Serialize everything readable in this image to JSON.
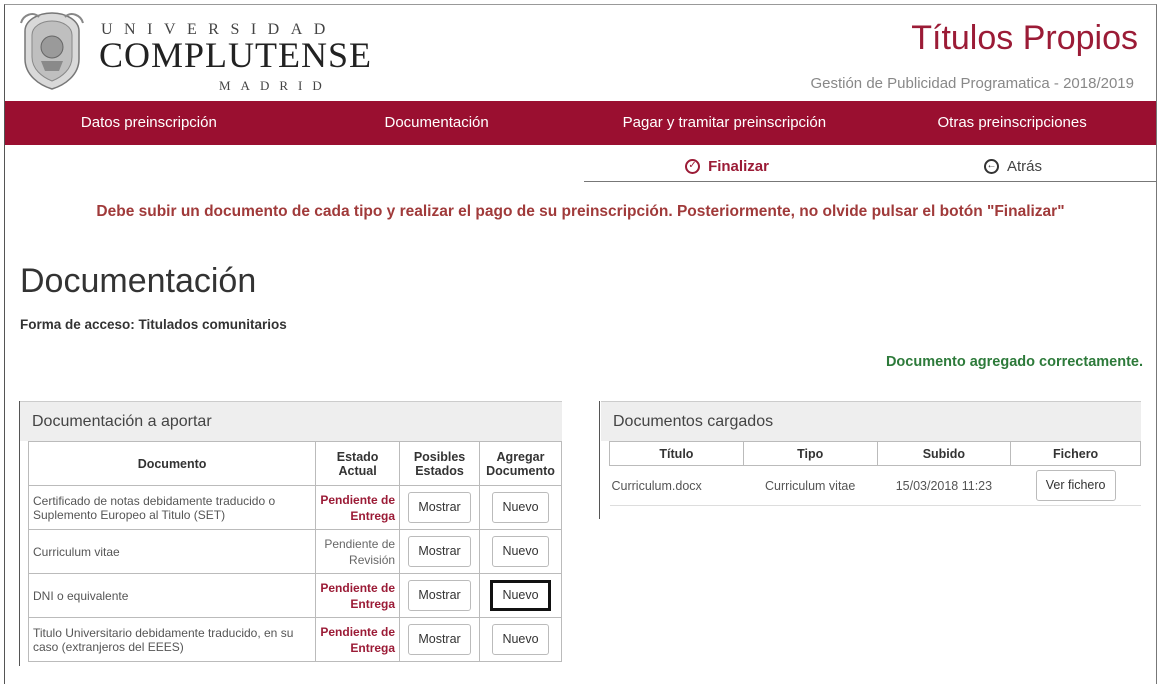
{
  "header": {
    "logo_line1": "UNIVERSIDAD",
    "logo_line2": "COMPLUTENSE",
    "logo_line3": "MADRID",
    "site_title": "Títulos Propios",
    "site_subtitle": "Gestión de Publicidad Programatica - 2018/2019"
  },
  "nav": {
    "items": [
      "Datos preinscripción",
      "Documentación",
      "Pagar y tramitar preinscripción",
      "Otras preinscripciones"
    ]
  },
  "actions": {
    "finalizar": "Finalizar",
    "atras": "Atrás"
  },
  "warning": "Debe subir un documento de cada tipo y realizar el pago de su preinscripción. Posteriormente, no olvide pulsar el botón \"Finalizar\"",
  "page_title": "Documentación",
  "access": "Forma de acceso: Titulados comunitarios",
  "success_message": "Documento agregado correctamente.",
  "left_panel": {
    "title": "Documentación a aportar",
    "headers": {
      "documento": "Documento",
      "estado": "Estado Actual",
      "posibles": "Posibles Estados",
      "agregar": "Agregar Documento"
    },
    "show_label": "Mostrar",
    "new_label": "Nuevo",
    "rows": [
      {
        "documento": "Certificado de notas debidamente traducido o Suplemento Europeo al Titulo (SET)",
        "estado": "Pendiente de Entrega"
      },
      {
        "documento": "Curriculum vitae",
        "estado": "Pendiente de Revisión"
      },
      {
        "documento": "DNI o equivalente",
        "estado": "Pendiente de Entrega"
      },
      {
        "documento": "Titulo Universitario debidamente traducido, en su caso (extranjeros del EEES)",
        "estado": "Pendiente de Entrega"
      }
    ]
  },
  "right_panel": {
    "title": "Documentos cargados",
    "headers": {
      "titulo": "Título",
      "tipo": "Tipo",
      "subido": "Subido",
      "fichero": "Fichero"
    },
    "rows": [
      {
        "titulo": "Curriculum.docx",
        "tipo": "Curriculum vitae",
        "subido": "15/03/2018 11:23",
        "fichero": "Ver fichero"
      }
    ]
  },
  "colors": {
    "brand": "#9a0f30",
    "success": "#2d7a3a",
    "warning": "#a03a3a"
  }
}
